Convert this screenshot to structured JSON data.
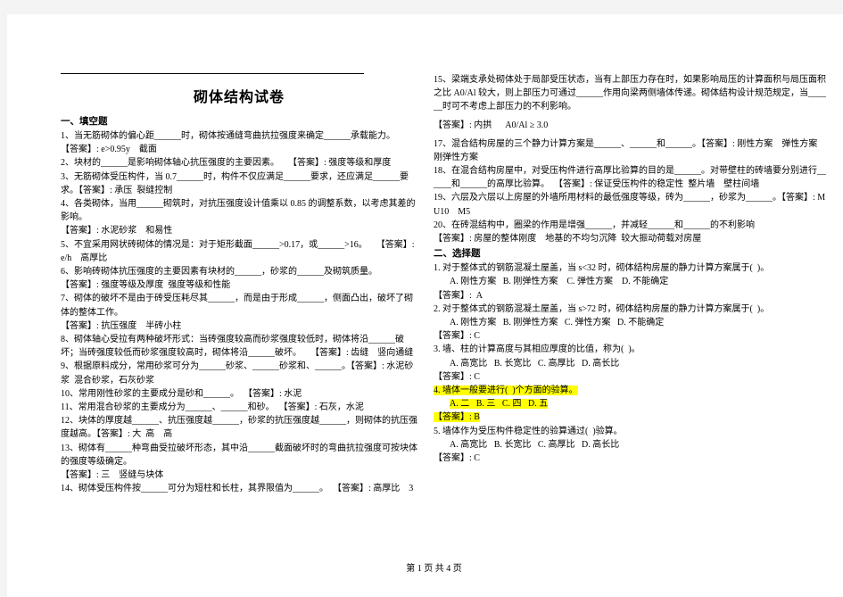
{
  "document": {
    "title": "砌体结构试卷",
    "footer": "第 1 页 共 4 页",
    "highlight_color": "#ffff00"
  },
  "left_column": {
    "section_heading": "一、填空题",
    "lines": [
      "1、当无筋砌体的偏心距______时，砌体按通缝弯曲抗拉强度来确定______承载能力。",
      "【答案】: e>0.95y    截面",
      "2、块材的______是影响砌体轴心抗压强度的主要因素。    【答案】: 强度等级和厚度",
      "3、无筋砌体受压构件，当 0.7______时，构件不仅应满足______要求，还应满足______要求。【答案】: 承压  裂缝控制",
      "4、各类砌体，当用______砌筑时，对抗压强度设计值乘以 0.85 的调整系数，以考虑其差的影响。",
      "【答案】: 水泥砂浆    和易性",
      "5、不宜采用网状砖砌体的情况是：对于矩形截面______>0.17，或______>16。    【答案】: e/h    高厚比",
      "6、影响砖砌体抗压强度的主要因素有块材的______，砂浆的______及砌筑质量。",
      "【答案】: 强度等级及厚度  强度等级和性能",
      "7、砌体的破坏不是由于砖受压耗尽其______，而是由于形成______，侧面凸出，破坏了砌体的整体工作。",
      "【答案】: 抗压强度    半砖小柱",
      "8、砌体轴心受拉有两种破坏形式：当砖强度较高而砂浆强度较低时，砌体将沿______破坏；当砖强度较低而砂浆强度较高时，砌体将沿______破坏。    【答案】: 齿缝    竖向通缝",
      "9、根据原料成分，常用砂浆可分为______砂浆、______砂浆和、______。【答案】: 水泥砂浆  混合砂浆，石灰砂浆",
      "10、常用刚性砂浆的主要成分是砂和______。  【答案】: 水泥",
      "11、常用混合砂浆的主要成分为______、______和砂。  【答案】: 石灰，水泥",
      "12、块体的厚度越______、抗压强度越______，砂浆的抗压强度越______，则砌体的抗压强度越高。【答案】: 大  高    高",
      "13、砌体有______种弯曲受拉破坏形态，其中沿______截面破坏时的弯曲抗拉强度可按块体的强度等级确定。",
      "【答案】: 三    竖缝与块体",
      "14、砌体受压构件按______可分为短柱和长柱，其界限值为______。  【答案】: 高厚比    3"
    ]
  },
  "right_column": {
    "fill_lines": [
      "15、梁端支承处砌体处于局部受压状态，当有上部压力存在时，如果影响局压的计算面积与局压面积之比 A0/Al 较大，则上部压力可通过______作用向梁两侧墙体传递。砌体结构设计规范规定，当______时可不考虑上部压力的不利影响。",
      "【答案】: 内拱      A0/Al ≥ 3.0",
      "17、混合结构房屋的三个静力计算方案是______、______和______。【答案】: 刚性方案    弹性方案    刚弹性方案",
      "18、在混合结构房屋中，对受压构件进行高厚比验算的目的是______。对带壁柱的砖墙要分别进行______和______的高厚比验算。  【答案】: 保证受压构件的稳定性  整片墙    壁柱间墙",
      "19、六层及六层以上房屋的外墙所用材料的最低强度等级，砖为______，砂浆为______。【答案】: MU10    M5",
      "20、在砖混结构中，圈梁的作用是增强______，并减轻______和______的不利影响",
      "【答案】: 房屋的整体刚度    地基的不均匀沉降  较大振动荷载对房屋"
    ],
    "choice_heading": "二、选择题",
    "questions": [
      {
        "stem": "1. 对于整体式的钢筋混凝土屋盖，当 s<32 时，砌体结构房屋的静力计算方案属于(  )。",
        "options": "A. 刚性方案   B. 刚弹性方案    C. 弹性方案    D. 不能确定",
        "answer": "【答案】:  A",
        "highlight": false
      },
      {
        "stem": "2. 对于整体式的钢筋混凝土屋盖，当 s>72 时，砌体结构房屋的静力计算方案属于(  )。",
        "options": "A. 刚性方案   B. 刚弹性方案   C. 弹性方案   D. 不能确定",
        "answer": "【答案】: C",
        "highlight": false
      },
      {
        "stem": "3. 墙、柱的计算高度与其相应厚度的比值，称为(  )。",
        "options": "A. 高宽比   B. 长宽比   C. 高厚比   D. 高长比",
        "answer": "【答案】: C",
        "highlight": false
      },
      {
        "stem": "4. 墙体一般要进行(  )个方面的验算。",
        "options": "A. 二   B. 三   C. 四   D. 五",
        "answer": "【答案】: B",
        "highlight": true
      },
      {
        "stem": "5. 墙体作为受压构件稳定性的验算通过(  )验算。",
        "options": "A. 高宽比   B. 长宽比   C. 高厚比   D. 高长比",
        "answer": "【答案】: C",
        "highlight": false
      }
    ]
  }
}
